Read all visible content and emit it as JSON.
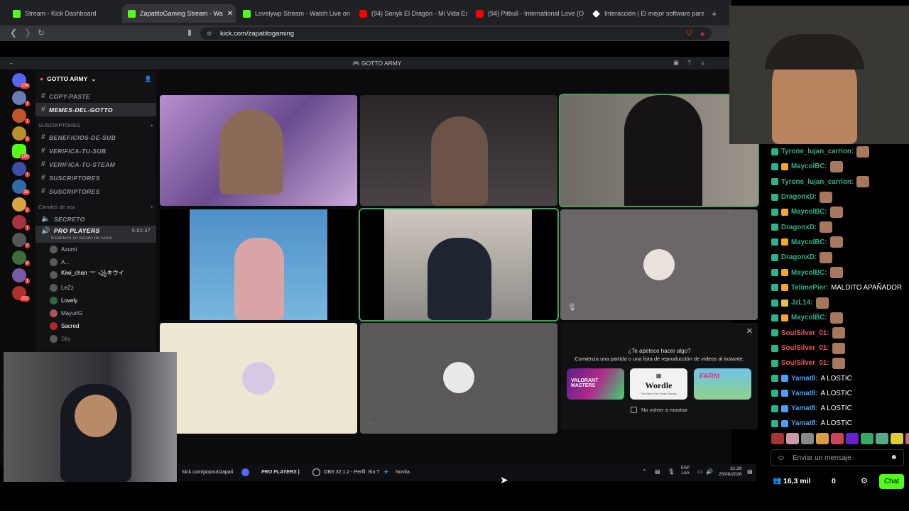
{
  "browser": {
    "tabs": [
      {
        "title": "Stream - Kick Dashboard",
        "icon": "kick-icon"
      },
      {
        "title": "ZapatitoGaming Stream - Wa",
        "icon": "kick-icon",
        "active": true
      },
      {
        "title": "Lovelywp Stream - Watch Live on Kic",
        "icon": "kick-icon"
      },
      {
        "title": "(94) Sonyk El Dragón - Mi Vida Es",
        "icon": "youtube-icon"
      },
      {
        "title": "(94) Pitbull - International Love (Offic",
        "icon": "youtube-icon"
      },
      {
        "title": "Interacción | El mejor software para p",
        "icon": "diamond-icon"
      }
    ],
    "url": "kick.com/zapatitogaming"
  },
  "discord": {
    "window_title": "GOTTO ARMY",
    "server_name": "GOTTO ARMY",
    "text_channels": [
      "COPY-PASTE",
      "MEMES-DEL-GOTTO"
    ],
    "category_subs": "SUSCRIPTORES",
    "sub_channels": [
      "BENEFICIOS-DE-SUB",
      "VERIFICA-TU-SUB",
      "VERIFICA-TU-STEAM",
      "SUSCRIPTORES",
      "SUSCRIPTORES"
    ],
    "category_voice": "Canales de voz",
    "voice_channels": [
      "SECRETO",
      "PRO PLAYERS"
    ],
    "voice_timer": "6:02:37",
    "voice_status": "Establece un estado de canal",
    "voice_members": [
      "Azumi",
      "A...",
      "Kiwi_chan ⁻ˢ⁻ ꧁キウイ",
      "LeZz",
      "Lovely",
      "MayuriG",
      "Sacred",
      "Sky"
    ],
    "server_badges": [
      "234",
      "1",
      "1",
      "3",
      "185",
      "1",
      "15",
      "2",
      "1",
      "2",
      "3",
      "1",
      "202"
    ]
  },
  "popup": {
    "title": "¿Te apetece hacer algo?",
    "subtitle": "Comienza una partida o una lista de reproducción de vídeos al instante.",
    "games": [
      "VALORANT MASTERS",
      "Wordle",
      "FARM"
    ],
    "wordle_sub": "The New York Times Games",
    "checkbox_label": "No volver a mostrar"
  },
  "taskbar": {
    "items": [
      "kick.com/popout/zapati",
      "PRO PLAYERS |",
      "OBS 32.1.2 - Perfil: Sin T",
      "Novita"
    ],
    "lang": "ESP",
    "lang2": "LAA",
    "time": "21:26",
    "date": "25/08/2026"
  },
  "chat": {
    "messages": [
      {
        "user": "Tyrone_lujan_carrion:",
        "text": "",
        "color": "#2cb388",
        "badge": "none"
      },
      {
        "user": "MaycolBC:",
        "text": "",
        "color": "#2cb388",
        "badge": "k"
      },
      {
        "user": "Tyrone_lujan_carrion:",
        "text": "",
        "color": "#2cb388",
        "badge": "none"
      },
      {
        "user": "DragonxD:",
        "text": "",
        "color": "#2cb388",
        "badge": "none"
      },
      {
        "user": "MaycolBC:",
        "text": "",
        "color": "#2cb388",
        "badge": "k"
      },
      {
        "user": "DragonxD:",
        "text": "",
        "color": "#2cb388",
        "badge": "none"
      },
      {
        "user": "MaycolBC:",
        "text": "",
        "color": "#2cb388",
        "badge": "k"
      },
      {
        "user": "DragonxD:",
        "text": "",
        "color": "#2cb388",
        "badge": "none"
      },
      {
        "user": "MaycolBC:",
        "text": "",
        "color": "#2cb388",
        "badge": "k"
      },
      {
        "user": "TelimePier:",
        "text": "MALDITO APAÑADOR",
        "color": "#2cb388",
        "badge": "k"
      },
      {
        "user": "JzL14:",
        "text": "",
        "color": "#2cb388",
        "badge": "g"
      },
      {
        "user": "MaycolBC:",
        "text": "",
        "color": "#2cb388",
        "badge": "k"
      },
      {
        "user": "SoulSilver_01:",
        "text": "",
        "color": "#e95a5a",
        "badge": "none"
      },
      {
        "user": "SoulSilver_01:",
        "text": "",
        "color": "#e95a5a",
        "badge": "none"
      },
      {
        "user": "SoulSilver_01:",
        "text": "",
        "color": "#e95a5a",
        "badge": "none"
      },
      {
        "user": "Yamat8:",
        "text": "A LOSTIC",
        "color": "#4a9ff5",
        "badge": "a"
      },
      {
        "user": "Yamat8:",
        "text": "A LOSTIC",
        "color": "#4a9ff5",
        "badge": "a"
      },
      {
        "user": "Yamat8:",
        "text": "A LOSTIC",
        "color": "#4a9ff5",
        "badge": "a"
      },
      {
        "user": "Yamat8:",
        "text": "A LOSTIC",
        "color": "#4a9ff5",
        "badge": "a"
      }
    ],
    "input_placeholder": "Enviar un mensaje",
    "viewers": "16,3 mil",
    "counter": "0",
    "chat_button": "Chat"
  },
  "colors": {
    "kick_green": "#53fc18",
    "discord_bg": "#0b0b0c",
    "speaking": "#3ba55c"
  }
}
